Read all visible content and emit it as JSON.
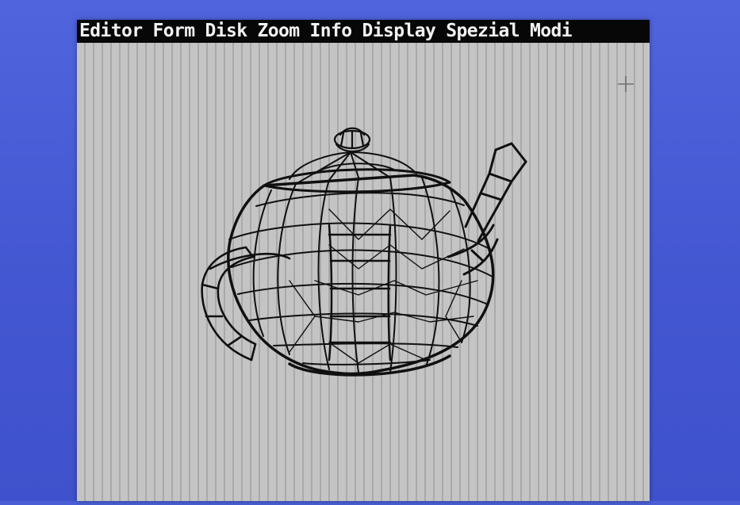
{
  "menubar": {
    "items": [
      "Editor",
      "Form",
      "Disk",
      "Zoom",
      "Info",
      "Display",
      "Spezial",
      "Modi"
    ]
  },
  "canvas": {
    "subject": "teapot-wireframe",
    "cursor_icon": "crosshair-icon"
  },
  "colors": {
    "outer_background": "#4a5fd6",
    "canvas_background": "#b9b9b9",
    "menubar_background": "#070707",
    "menubar_text": "#f2f2f2",
    "wireframe_stroke": "#101010"
  }
}
